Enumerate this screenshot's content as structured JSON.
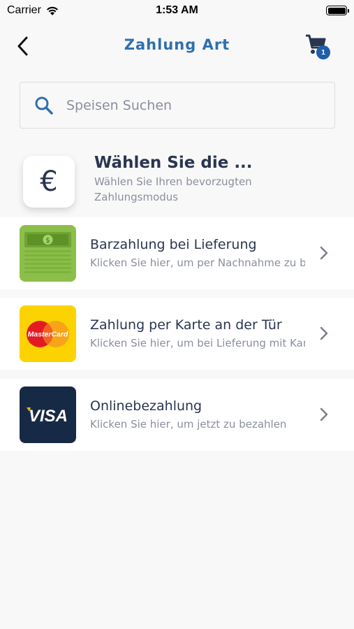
{
  "status_bar": {
    "carrier": "Carrier",
    "time": "1:53 AM"
  },
  "nav": {
    "title": "Zahlung Art",
    "cart_count": "1"
  },
  "search": {
    "placeholder": "Speisen Suchen"
  },
  "choose": {
    "icon_symbol": "€",
    "title": "Wählen Sie die ...",
    "subtitle": "Wählen Sie Ihren bevorzugten Zahlungsmodus"
  },
  "payment_methods": [
    {
      "icon": "cash-icon",
      "title": "Barzahlung bei Lieferung",
      "subtitle": "Klicken Sie hier, um per Nachnahme zu bezahlen"
    },
    {
      "icon": "mastercard-icon",
      "title": "Zahlung per Karte an der Tür",
      "subtitle": "Klicken Sie hier, um bei Lieferung mit Karte zu bezahlen",
      "brand_text": "MasterCard"
    },
    {
      "icon": "visa-icon",
      "title": "Onlinebezahlung",
      "subtitle": "Klicken Sie hier, um jetzt zu bezahlen",
      "brand_text": "VISA"
    }
  ],
  "colors": {
    "accent": "#2f6fae",
    "badge": "#1f5ea8",
    "text": "#2a3550",
    "muted": "#8a8f9c"
  }
}
